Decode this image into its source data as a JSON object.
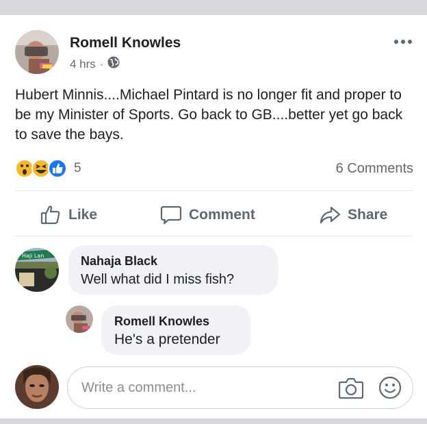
{
  "post": {
    "author": "Romell Knowles",
    "time": "4 hrs",
    "separator": "·",
    "privacy_icon": "globe-icon",
    "text": "Hubert Minnis....Michael Pintard is no longer fit and proper to be my Minister of Sports. Go back to GB....better yet go back to save the bays.",
    "reactions": {
      "icons": [
        "wow-reaction-icon",
        "haha-reaction-icon",
        "like-reaction-icon"
      ],
      "count": "5"
    },
    "comments_count": "6 Comments"
  },
  "actions": {
    "like": "Like",
    "comment": "Comment",
    "share": "Share"
  },
  "comments": [
    {
      "name": "Nahaja Black",
      "text": "Well what did I miss fish?",
      "avatar_sign_text": "Haji Lan"
    },
    {
      "name": "Romell Knowles",
      "text": "He's a pretender"
    }
  ],
  "composer": {
    "placeholder": "Write a comment...",
    "camera_icon": "camera-icon",
    "emoji_icon": "emoji-icon"
  },
  "colors": {
    "text_primary": "#1c1e21",
    "text_secondary": "#65676b",
    "bubble": "#f0f2f5",
    "like_blue": "#1877f2",
    "reaction_yellow": "#f7b928"
  }
}
